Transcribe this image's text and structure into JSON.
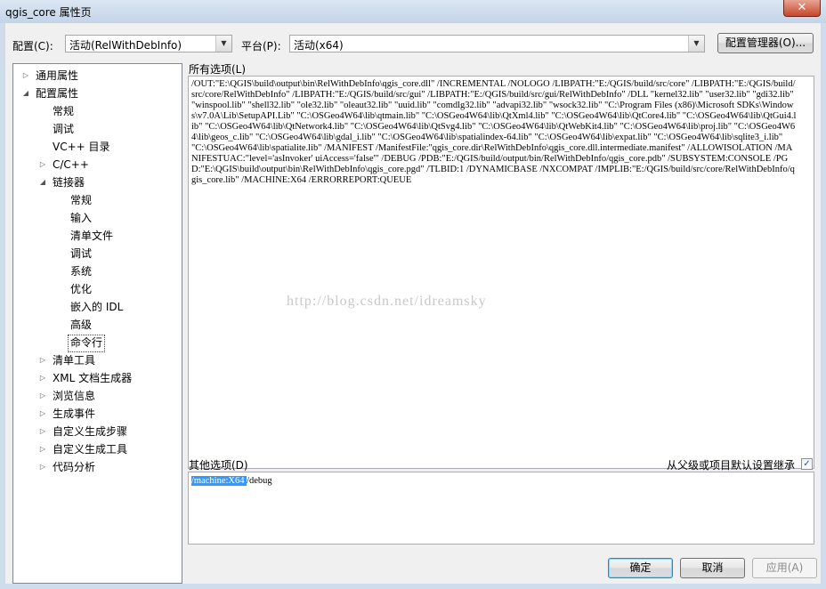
{
  "window": {
    "title": "qgis_core 属性页",
    "close_glyph": "✕"
  },
  "toolbar": {
    "config_label": "配置(C):",
    "config_value": "活动(RelWithDebInfo)",
    "platform_label": "平台(P):",
    "platform_value": "活动(x64)",
    "config_manager_button": "配置管理器(O)..."
  },
  "tree": {
    "items": [
      {
        "label": "通用属性",
        "level": 0,
        "expander": "collapsed"
      },
      {
        "label": "配置属性",
        "level": 0,
        "expander": "expanded"
      },
      {
        "label": "常规",
        "level": 1,
        "expander": "none"
      },
      {
        "label": "调试",
        "level": 1,
        "expander": "none"
      },
      {
        "label": "VC++ 目录",
        "level": 1,
        "expander": "none"
      },
      {
        "label": "C/C++",
        "level": 1,
        "expander": "collapsed"
      },
      {
        "label": "链接器",
        "level": 1,
        "expander": "expanded"
      },
      {
        "label": "常规",
        "level": 2,
        "expander": "none"
      },
      {
        "label": "输入",
        "level": 2,
        "expander": "none"
      },
      {
        "label": "清单文件",
        "level": 2,
        "expander": "none"
      },
      {
        "label": "调试",
        "level": 2,
        "expander": "none"
      },
      {
        "label": "系统",
        "level": 2,
        "expander": "none"
      },
      {
        "label": "优化",
        "level": 2,
        "expander": "none"
      },
      {
        "label": "嵌入的 IDL",
        "level": 2,
        "expander": "none"
      },
      {
        "label": "高级",
        "level": 2,
        "expander": "none"
      },
      {
        "label": "命令行",
        "level": 2,
        "expander": "none",
        "selected": true
      },
      {
        "label": "清单工具",
        "level": 1,
        "expander": "collapsed"
      },
      {
        "label": "XML 文档生成器",
        "level": 1,
        "expander": "collapsed"
      },
      {
        "label": "浏览信息",
        "level": 1,
        "expander": "collapsed"
      },
      {
        "label": "生成事件",
        "level": 1,
        "expander": "collapsed"
      },
      {
        "label": "自定义生成步骤",
        "level": 1,
        "expander": "collapsed"
      },
      {
        "label": "自定义生成工具",
        "level": 1,
        "expander": "collapsed"
      },
      {
        "label": "代码分析",
        "level": 1,
        "expander": "collapsed"
      }
    ]
  },
  "all_options": {
    "label": "所有选项(L)",
    "text": "/OUT:\"E:\\QGIS\\build\\output\\bin\\RelWithDebInfo\\qgis_core.dll\" /INCREMENTAL /NOLOGO /LIBPATH:\"E:/QGIS/build/src/core\" /LIBPATH:\"E:/QGIS/build/src/core/RelWithDebInfo\" /LIBPATH:\"E:/QGIS/build/src/gui\" /LIBPATH:\"E:/QGIS/build/src/gui/RelWithDebInfo\" /DLL \"kernel32.lib\" \"user32.lib\" \"gdi32.lib\" \"winspool.lib\" \"shell32.lib\" \"ole32.lib\" \"oleaut32.lib\" \"uuid.lib\" \"comdlg32.lib\" \"advapi32.lib\" \"wsock32.lib\" \"C:\\Program Files (x86)\\Microsoft SDKs\\Windows\\v7.0A\\Lib\\SetupAPI.Lib\" \"C:\\OSGeo4W64\\lib\\qtmain.lib\" \"C:\\OSGeo4W64\\lib\\QtXml4.lib\" \"C:\\OSGeo4W64\\lib\\QtCore4.lib\" \"C:\\OSGeo4W64\\lib\\QtGui4.lib\" \"C:\\OSGeo4W64\\lib\\QtNetwork4.lib\" \"C:\\OSGeo4W64\\lib\\QtSvg4.lib\" \"C:\\OSGeo4W64\\lib\\QtWebKit4.lib\" \"C:\\OSGeo4W64\\lib\\proj.lib\" \"C:\\OSGeo4W64\\lib\\geos_c.lib\" \"C:\\OSGeo4W64\\lib\\gdal_i.lib\" \"C:\\OSGeo4W64\\lib\\spatialindex-64.lib\" \"C:\\OSGeo4W64\\lib\\expat.lib\" \"C:\\OSGeo4W64\\lib\\sqlite3_i.lib\" \"C:\\OSGeo4W64\\lib\\spatialite.lib\" /MANIFEST /ManifestFile:\"qgis_core.dir\\RelWithDebInfo\\qgis_core.dll.intermediate.manifest\" /ALLOWISOLATION /MANIFESTUAC:\"level='asInvoker' uiAccess='false'\" /DEBUG /PDB:\"E:/QGIS/build/output/bin/RelWithDebInfo/qgis_core.pdb\" /SUBSYSTEM:CONSOLE /PGD:\"E:\\QGIS\\build\\output\\bin\\RelWithDebInfo\\qgis_core.pgd\" /TLBID:1 /DYNAMICBASE /NXCOMPAT /IMPLIB:\"E:/QGIS/build/src/core/RelWithDebInfo/qgis_core.lib\" /MACHINE:X64 /ERRORREPORT:QUEUE",
    "watermark": "http://blog.csdn.net/idreamsky"
  },
  "other_options": {
    "label": "其他选项(D)",
    "selected_text": "/machine:X64 ",
    "rest_text": "/debug",
    "inherit_label": "从父级或项目默认设置继承",
    "inherit_checked": true,
    "check_glyph": "✓"
  },
  "footer": {
    "ok": "确定",
    "cancel": "取消",
    "apply": "应用(A)"
  },
  "glyphs": {
    "combo_arrow": "▼",
    "collapsed": "▷",
    "expanded": "◢"
  }
}
